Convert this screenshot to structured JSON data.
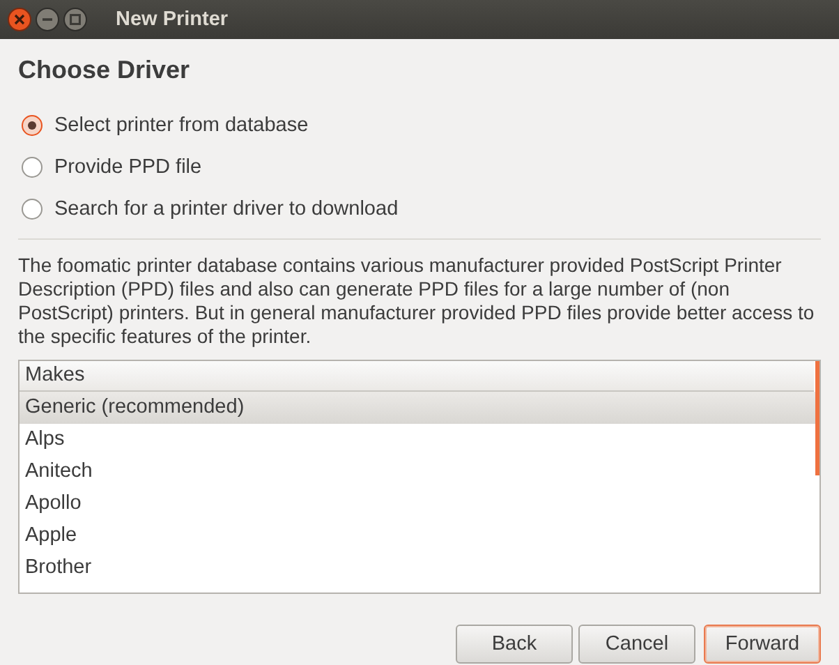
{
  "window": {
    "title": "New Printer"
  },
  "heading": "Choose Driver",
  "options": [
    {
      "label": "Select printer from database",
      "selected": true
    },
    {
      "label": "Provide PPD file",
      "selected": false
    },
    {
      "label": "Search for a printer driver to download",
      "selected": false
    }
  ],
  "description": "The foomatic printer database contains various manufacturer provided PostScript Printer Description (PPD) files and also can generate PPD files for a large number of (non PostScript) printers. But in general manufacturer provided PPD files provide better access to the specific features of the printer.",
  "makes": {
    "column": "Makes",
    "rows": [
      {
        "label": "Generic (recommended)",
        "selected": true
      },
      {
        "label": "Alps",
        "selected": false
      },
      {
        "label": "Anitech",
        "selected": false
      },
      {
        "label": "Apollo",
        "selected": false
      },
      {
        "label": "Apple",
        "selected": false
      },
      {
        "label": "Brother",
        "selected": false
      }
    ]
  },
  "buttons": [
    {
      "label": "Back",
      "default": false
    },
    {
      "label": "Cancel",
      "default": false
    },
    {
      "label": "Forward",
      "default": true
    }
  ]
}
